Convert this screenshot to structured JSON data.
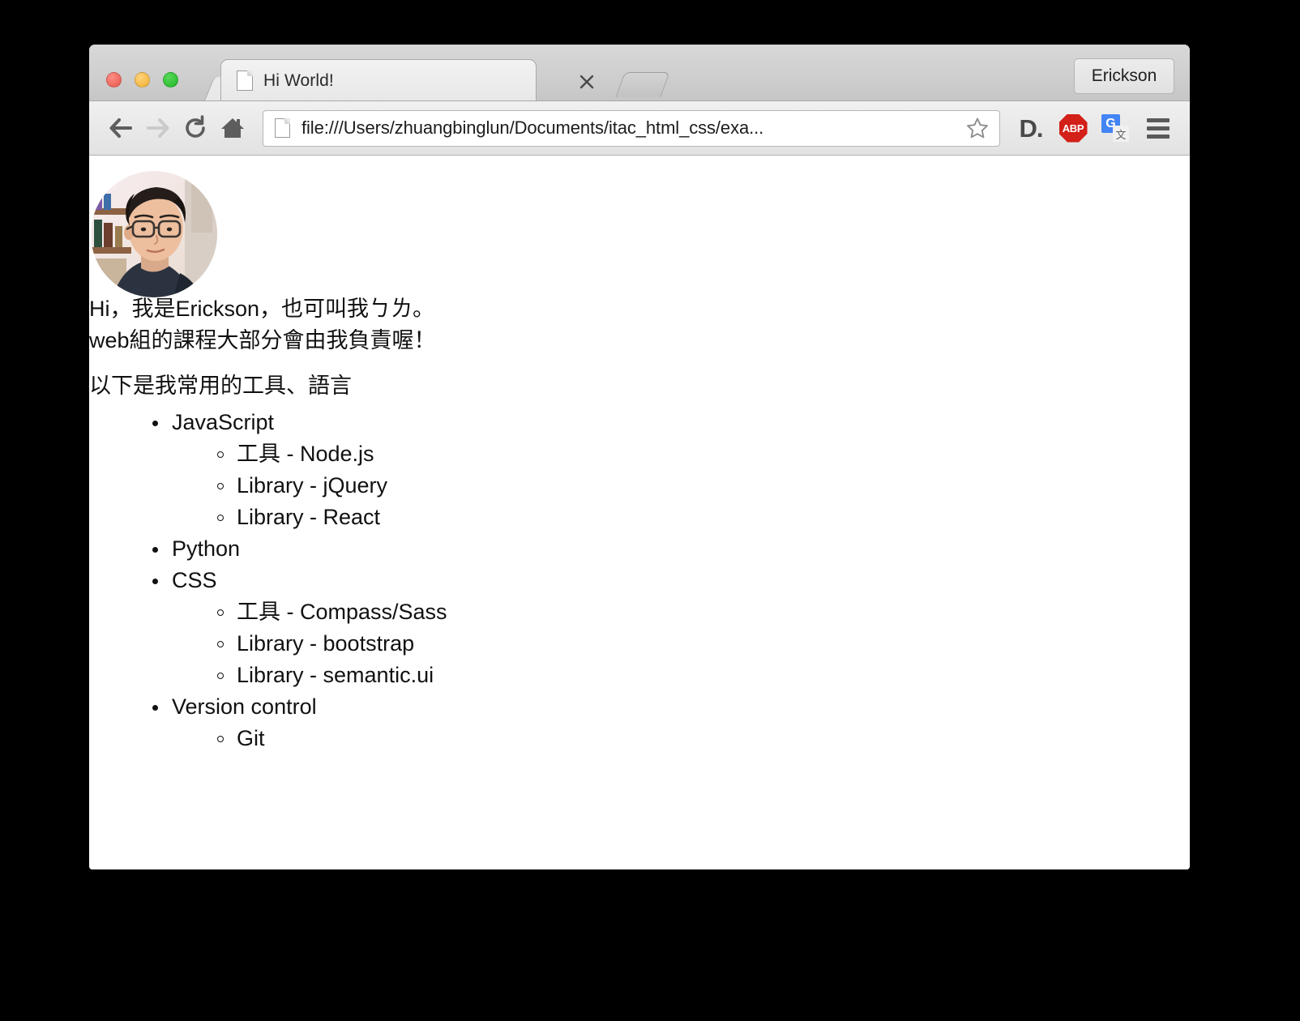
{
  "window": {
    "traffic_lights": [
      {
        "name": "close",
        "color": "#e8564c"
      },
      {
        "name": "minimize",
        "color": "#f2ae33"
      },
      {
        "name": "maximize",
        "color": "#1fb723"
      }
    ]
  },
  "tab_strip": {
    "active_tab": {
      "title": "Hi World!",
      "favicon": "document-icon",
      "close_label": "×"
    },
    "new_tab_label": "",
    "profile_button_label": "Erickson"
  },
  "toolbar": {
    "back_label": "",
    "forward_label": "",
    "reload_label": "",
    "home_label": "",
    "omnibox": {
      "url": "file:///Users/zhuangbinglun/Documents/itac_html_css/exa...",
      "placeholder": "Search Google or type a URL",
      "favicon": "document-icon"
    },
    "bookmark_star": "star-outline-icon",
    "extensions": [
      {
        "name": "ext-d",
        "label": "D."
      },
      {
        "name": "ext-abp",
        "label": "ABP"
      },
      {
        "name": "ext-translate",
        "label_primary": "G",
        "label_secondary": "文"
      }
    ],
    "menu_label": ""
  },
  "page": {
    "avatar_alt": "Erickson profile photo",
    "intro": "Hi，我是Erickson，也可叫我ㄅㄌ。\nweb組的課程大部分會由我負責喔！",
    "tools_heading": "以下是我常用的工具、語言",
    "skills": [
      {
        "label": "JavaScript",
        "children": [
          "工具 - Node.js",
          "Library - jQuery",
          "Library - React"
        ]
      },
      {
        "label": "Python",
        "children": []
      },
      {
        "label": "CSS",
        "children": [
          "工具 - Compass/Sass",
          "Library - bootstrap",
          "Library - semantic.ui"
        ]
      },
      {
        "label": "Version control",
        "children": [
          "Git"
        ]
      }
    ]
  }
}
